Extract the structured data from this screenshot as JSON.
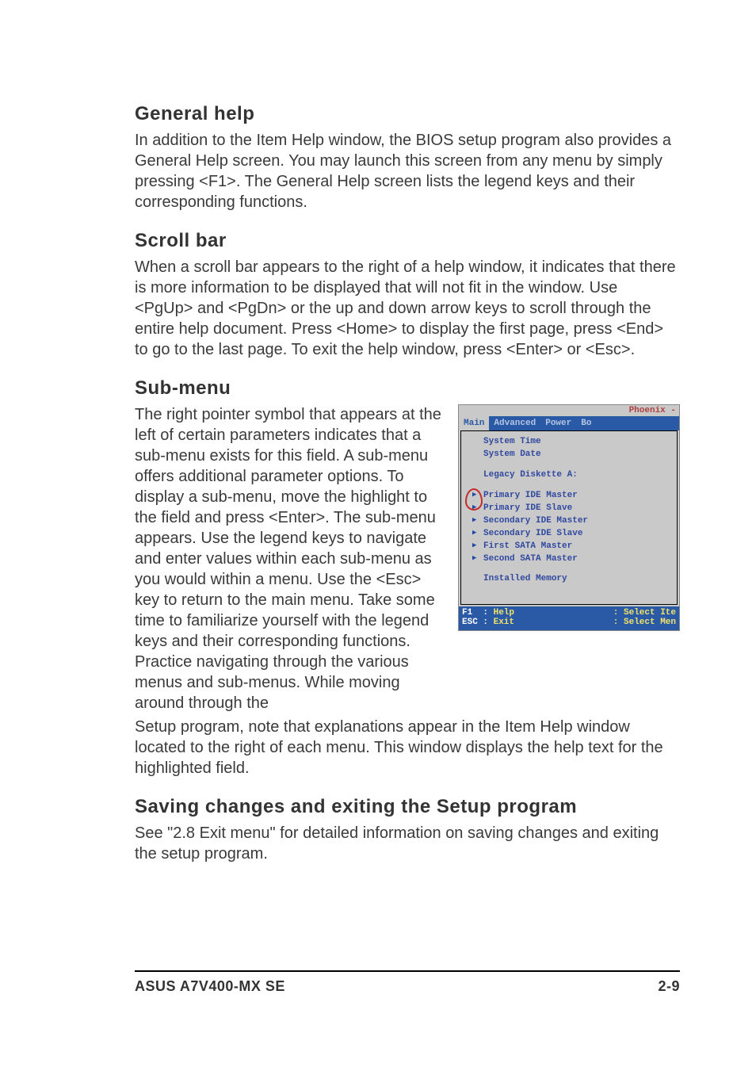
{
  "sections": {
    "general_help": {
      "heading": "General help",
      "body": "In addition to the Item Help window, the BIOS setup program also provides a General Help screen. You may launch this screen from any menu by simply pressing <F1>. The General Help screen lists the legend keys and their corresponding functions."
    },
    "scroll_bar": {
      "heading": "Scroll bar",
      "body": "When a scroll bar appears to the right of a help window, it indicates that there is more information to be displayed that will not fit in the window. Use <PgUp> and <PgDn> or the up and down arrow keys to scroll through the entire help document. Press <Home> to display the first page, press <End> to go to the last page. To exit the help window, press <Enter> or <Esc>."
    },
    "sub_menu": {
      "heading": "Sub-menu",
      "body_beside": "The right pointer symbol that appears at the left of certain parameters indicates that a sub-menu exists  for this field. A sub-menu offers additional parameter options. To display a sub-menu, move the highlight to the field and press <Enter>. The sub-menu appears. Use the legend keys to navigate and enter values within each sub-menu as you would within a menu. Use the <Esc> key to return to the main menu. Take some time to familiarize yourself with the legend keys and their corresponding functions. Practice navigating through the various menus and sub-menus. While moving around through the",
      "body_after": "Setup program, note that explanations appear in the Item Help window located to the right of each menu. This window displays the help text for the highlighted field."
    },
    "saving": {
      "heading": "Saving changes and exiting the Setup program",
      "body": "See \"2.8 Exit menu\" for detailed information on saving changes and exiting the setup program."
    }
  },
  "bios": {
    "brand": "Phoenix -",
    "tabs": [
      "Main",
      "Advanced",
      "Power",
      "Bo"
    ],
    "lines": {
      "sys_time": "System Time",
      "sys_date": "System Date",
      "legacy": "Legacy Diskette A:",
      "installed": "Installed Memory"
    },
    "pointer_items": [
      "Primary IDE Master",
      "Primary IDE Slave",
      "Secondary IDE Master",
      "Secondary IDE Slave",
      "First SATA Master",
      "Second SATA Master"
    ],
    "footer": {
      "f1": "F1  : ",
      "f1_act": "Help",
      "esc": "ESC : ",
      "esc_act": "Exit",
      "right1": ": Select Ite",
      "right2": ": Select Men"
    }
  },
  "footer": {
    "left": "ASUS A7V400-MX SE",
    "right": "2-9"
  }
}
